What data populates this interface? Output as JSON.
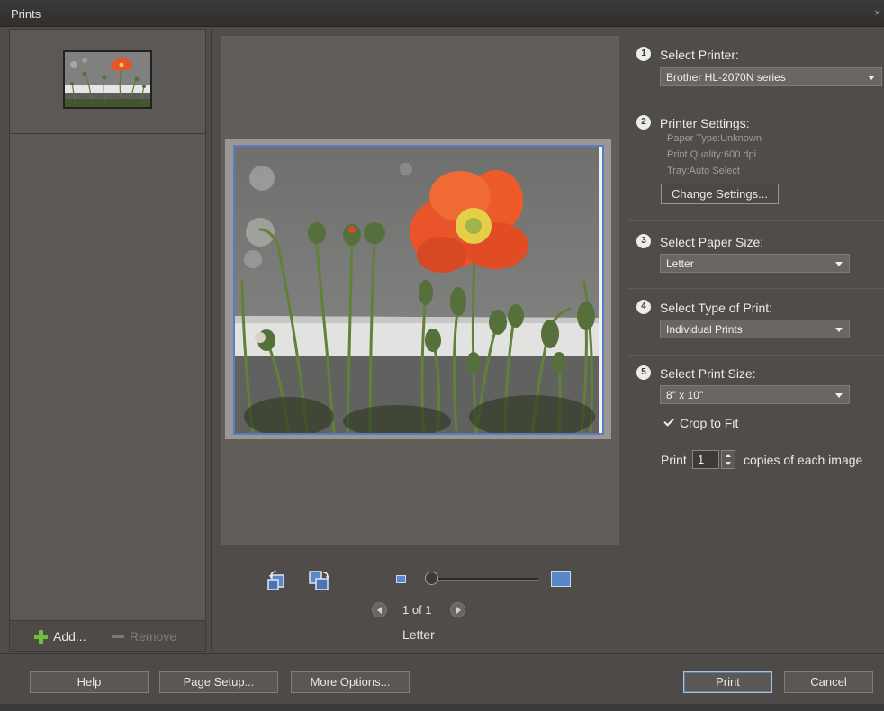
{
  "window": {
    "title": "Prints",
    "close_glyph": "×"
  },
  "left_panel": {
    "add_label": "Add...",
    "remove_label": "Remove"
  },
  "preview": {
    "page_count": "1 of 1",
    "paper_label": "Letter"
  },
  "steps": {
    "printer": {
      "num": "1",
      "title": "Select Printer:",
      "value": "Brother HL-2070N series"
    },
    "settings": {
      "num": "2",
      "title": "Printer Settings:",
      "paper_type": "Paper Type:Unknown",
      "print_quality": "Print Quality:600 dpi",
      "tray": "Tray:Auto Select",
      "change_button": "Change Settings..."
    },
    "paper_size": {
      "num": "3",
      "title": "Select Paper Size:",
      "value": "Letter"
    },
    "print_type": {
      "num": "4",
      "title": "Select Type of Print:",
      "value": "Individual Prints"
    },
    "print_size": {
      "num": "5",
      "title": "Select Print Size:",
      "value": "8\" x 10\"",
      "crop_label": "Crop to Fit",
      "print_label": "Print",
      "copies_value": "1",
      "copies_label": "copies of each image"
    }
  },
  "bottom": {
    "help": "Help",
    "page_setup": "Page Setup...",
    "more_options": "More Options...",
    "print": "Print",
    "cancel": "Cancel"
  },
  "icons": {
    "add": "plus-icon",
    "remove": "minus-icon",
    "rotate_left": "rotate-left-icon",
    "rotate_right": "rotate-right-icon",
    "zoom_small": "zoom-out-icon",
    "zoom_large": "zoom-in-icon",
    "prev": "previous-page-icon",
    "next": "next-page-icon",
    "checkbox": "checkmark-icon"
  },
  "colors": {
    "background": "#4f4c49",
    "accent": "#5a87c8",
    "add_green": "#6fbf3a"
  }
}
